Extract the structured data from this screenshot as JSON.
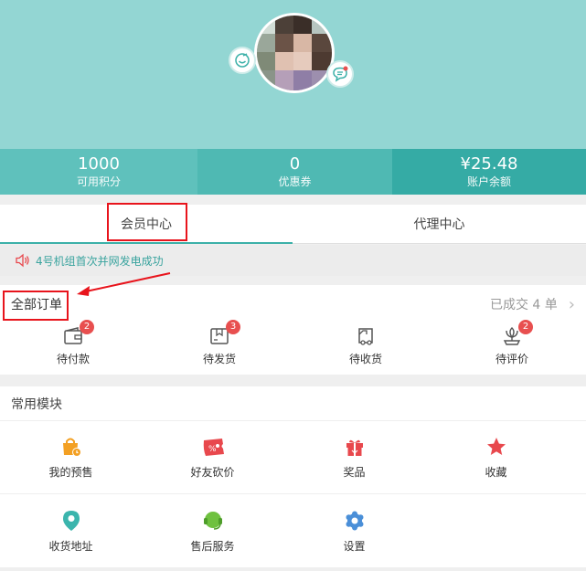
{
  "stats": [
    {
      "value": "1000",
      "label": "可用积分"
    },
    {
      "value": "0",
      "label": "优惠券"
    },
    {
      "value": "¥25.48",
      "label": "账户余额"
    }
  ],
  "tabs": [
    {
      "label": "会员中心",
      "active": true
    },
    {
      "label": "代理中心",
      "active": false
    }
  ],
  "notice": {
    "text": "4号机组首次并网发电成功",
    "icon": "speaker-icon"
  },
  "orders": {
    "title": "全部订单",
    "summary": "已成交 4 单",
    "items": [
      {
        "label": "待付款",
        "count": "2",
        "icon": "wallet-icon"
      },
      {
        "label": "待发货",
        "count": "3",
        "icon": "package-icon"
      },
      {
        "label": "待收货",
        "count": "",
        "icon": "truck-icon"
      },
      {
        "label": "待评价",
        "count": "2",
        "icon": "review-icon"
      }
    ]
  },
  "modules": {
    "title": "常用模块",
    "items": [
      {
        "label": "我的预售",
        "icon": "presale-bag-icon",
        "color": "#f3a023"
      },
      {
        "label": "好友砍价",
        "icon": "bargain-ticket-icon",
        "color": "#e8484d"
      },
      {
        "label": "奖品",
        "icon": "gift-icon",
        "color": "#e8484d"
      },
      {
        "label": "收藏",
        "icon": "star-icon",
        "color": "#e8484d"
      },
      {
        "label": "收货地址",
        "icon": "location-pin-icon",
        "color": "#3bb5ad"
      },
      {
        "label": "售后服务",
        "icon": "headset-icon",
        "color": "#6fc13f"
      },
      {
        "label": "设置",
        "icon": "gear-icon",
        "color": "#4a8fd8"
      }
    ]
  },
  "colors": {
    "header": "#93d6d3",
    "accent": "#35aba5",
    "badge": "#e84f4f",
    "annotation": "#e8141c"
  }
}
